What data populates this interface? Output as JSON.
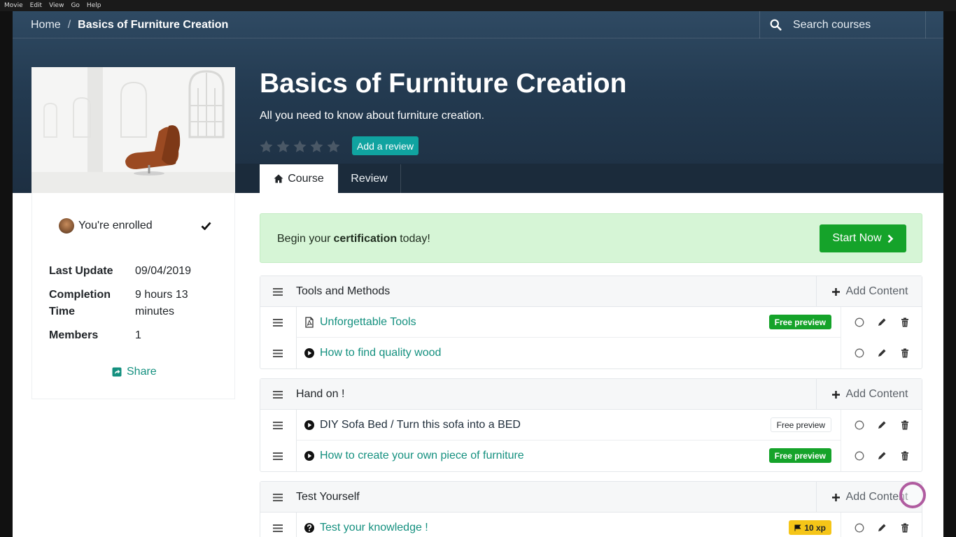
{
  "os_menu": [
    "Movie",
    "Edit",
    "View",
    "Go",
    "Help"
  ],
  "breadcrumb": {
    "home": "Home",
    "separator": "/",
    "current": "Basics of Furniture Creation"
  },
  "search": {
    "placeholder": "Search courses"
  },
  "course": {
    "title": "Basics of Furniture Creation",
    "subtitle": "All you need to know about furniture creation.",
    "rating_stars": 5,
    "add_review_label": "Add a review"
  },
  "tabs": [
    {
      "label": "Course",
      "icon": "home-icon",
      "active": true
    },
    {
      "label": "Review",
      "active": false
    }
  ],
  "sidebar": {
    "enrolled_label": "You're enrolled",
    "meta": [
      {
        "key": "Last Update",
        "value": "09/04/2019"
      },
      {
        "key": "Completion Time",
        "value": "9 hours 13 minutes"
      },
      {
        "key": "Members",
        "value": "1"
      }
    ],
    "share_label": "Share"
  },
  "certification": {
    "prefix": "Begin your",
    "bold": "certification",
    "suffix": "today!",
    "button": "Start Now"
  },
  "sections": [
    {
      "title": "Tools and Methods",
      "add_label": "Add Content",
      "items": [
        {
          "title": "Unforgettable Tools",
          "icon": "pdf-icon",
          "badge": "Free preview",
          "badge_style": "green"
        },
        {
          "title": "How to find quality wood",
          "icon": "play-icon"
        }
      ]
    },
    {
      "title": "Hand on !",
      "add_label": "Add Content",
      "items": [
        {
          "title": "DIY Sofa Bed / Turn this sofa into a BED",
          "icon": "play-icon",
          "badge": "Free preview",
          "badge_style": "outline"
        },
        {
          "title": "How to create your own piece of furniture",
          "icon": "play-icon",
          "badge": "Free preview",
          "badge_style": "green"
        }
      ]
    },
    {
      "title": "Test Yourself",
      "add_label": "Add Content",
      "items": [
        {
          "title": "Test your knowledge !",
          "icon": "question-icon",
          "badge": "10 xp",
          "badge_style": "xp"
        }
      ]
    }
  ],
  "colors": {
    "accent": "#14907f",
    "primary_green": "#15a32a",
    "header_dark": "#233a50",
    "xp_yellow": "#f5c518"
  }
}
